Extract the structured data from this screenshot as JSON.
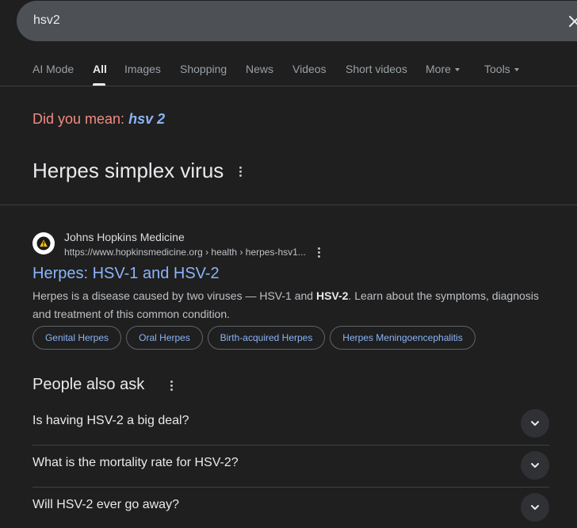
{
  "search": {
    "query": "hsv2"
  },
  "tabs": [
    {
      "label": "AI Mode"
    },
    {
      "label": "All"
    },
    {
      "label": "Images"
    },
    {
      "label": "Shopping"
    },
    {
      "label": "News"
    },
    {
      "label": "Videos"
    },
    {
      "label": "Short videos"
    },
    {
      "label": "More"
    },
    {
      "label": "Tools"
    }
  ],
  "did_you_mean": {
    "label": "Did you mean:",
    "suggestion": "hsv 2"
  },
  "knowledge_panel": {
    "title": "Herpes simplex virus"
  },
  "result": {
    "site_name": "Johns Hopkins Medicine",
    "url": "https://www.hopkinsmedicine.org › health › herpes-hsv1...",
    "title": "Herpes: HSV-1 and HSV-2",
    "snippet_before": "Herpes is a disease caused by two viruses — HSV-1 and ",
    "snippet_bold": "HSV-2",
    "snippet_after": ". Learn about the symptoms, diagnosis and treatment of this common condition.",
    "chips": [
      {
        "label": "Genital Herpes"
      },
      {
        "label": "Oral Herpes"
      },
      {
        "label": "Birth-acquired Herpes"
      },
      {
        "label": "Herpes Meningoencephalitis"
      }
    ]
  },
  "people_also_ask": {
    "title": "People also ask",
    "questions": [
      {
        "text": "Is having HSV-2 a big deal?"
      },
      {
        "text": "What is the mortality rate for HSV-2?"
      },
      {
        "text": "Will HSV-2 ever go away?"
      }
    ]
  },
  "colors": {
    "background": "#1f1f1f",
    "link": "#8ab4f8",
    "did_you_mean": "#f28b82",
    "search_bar": "#4d5156"
  }
}
